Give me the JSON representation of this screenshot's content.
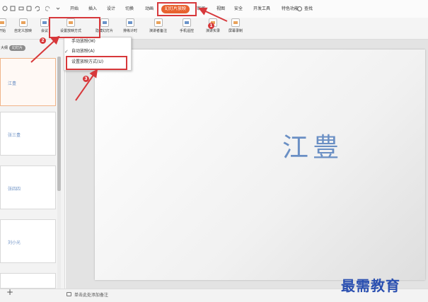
{
  "menubar": {
    "tabs": [
      "开始",
      "插入",
      "设计",
      "切换",
      "动画",
      "幻灯片放映",
      "审阅",
      "视图",
      "安全",
      "开发工具",
      "特色功能"
    ],
    "active_tab": "幻灯片放映",
    "search_label": "查找",
    "active_color": "#e8622e"
  },
  "ribbon": {
    "buttons": [
      "开始",
      "自定义放映",
      "会议",
      "设置放映方式",
      "隐藏幻灯片",
      "排练计时",
      "演讲者备注",
      "手机遥控",
      "演讲实录",
      "屏幕录制"
    ]
  },
  "leftpane": {
    "tab_outline": "大纲",
    "tab_slides": "幻灯片",
    "add_label": "+",
    "thumbnails": [
      "江豊",
      "张三豊",
      "张四四",
      "刘小光",
      ""
    ]
  },
  "dropdown": {
    "items": [
      "手动放映(M)",
      "自动放映(A)",
      "设置放映方式(U)"
    ],
    "checked_item": "自动放映(A)"
  },
  "slide": {
    "text": "江豊"
  },
  "statusbar": {
    "note_hint": "单击此处添加备注"
  },
  "annotations": {
    "steps": [
      "1",
      "2",
      "3"
    ],
    "color": "#d7383b"
  },
  "watermark": "最需教育"
}
